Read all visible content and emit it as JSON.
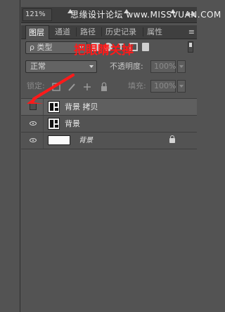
{
  "toolbar": {
    "zoom": "121%",
    "watermark": "思缘设计论坛  www.MISSVUAN.COM",
    "menu_glyph": "◀◀"
  },
  "tabs": [
    {
      "label": "图层",
      "active": true
    },
    {
      "label": "通道",
      "active": false
    },
    {
      "label": "路径",
      "active": false
    },
    {
      "label": "历史记录",
      "active": false
    },
    {
      "label": "属性",
      "active": false
    }
  ],
  "panel_menu_glyph": "≡",
  "filter": {
    "kind_label": "ρ 类型",
    "icons": [
      "image-filter-icon",
      "adjustment-filter-icon",
      "text-filter-icon",
      "shape-filter-icon",
      "smart-object-filter-icon"
    ]
  },
  "blend": {
    "mode": "正常",
    "opacity_label": "不透明度:",
    "opacity_value": "100%"
  },
  "lock_row": {
    "lock_label": "锁定:",
    "fill_label": "填充:",
    "fill_value": "100%"
  },
  "annotation": {
    "text": "把眼睛关掉",
    "color": "#ff1a1a"
  },
  "layers": [
    {
      "name": "背景 拷贝",
      "visible": false,
      "selected": true,
      "locked": false
    },
    {
      "name": "背景",
      "visible": true,
      "selected": false,
      "locked": false
    },
    {
      "name": "背景",
      "visible": true,
      "selected": false,
      "locked": true,
      "italic": true
    }
  ]
}
